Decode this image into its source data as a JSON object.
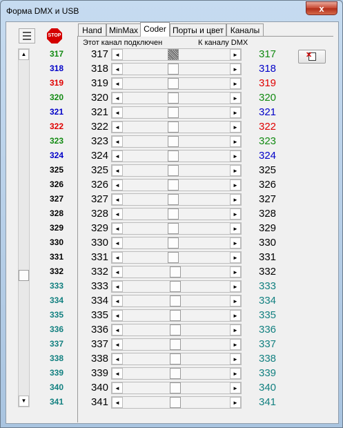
{
  "window": {
    "title": "Форма DMX и USB",
    "close_label": "x"
  },
  "toolbar": {
    "stop_label": "STOP"
  },
  "tabs": [
    {
      "label": "Hand",
      "active": false
    },
    {
      "label": "MinMax",
      "active": false
    },
    {
      "label": "Coder",
      "active": true
    },
    {
      "label": "Порты и цвет",
      "active": false
    },
    {
      "label": "Каналы",
      "active": false
    }
  ],
  "coder": {
    "header_left": "Этот канал подключен",
    "header_right": "К каналу DMX"
  },
  "channels": [
    {
      "channel": "317",
      "color": "#128a12",
      "slider_level": 0.47,
      "selected": true
    },
    {
      "channel": "318",
      "color": "#0000c8",
      "slider_level": 0.47
    },
    {
      "channel": "319",
      "color": "#e00000",
      "slider_level": 0.47
    },
    {
      "channel": "320",
      "color": "#128a12",
      "slider_level": 0.47
    },
    {
      "channel": "321",
      "color": "#0000c8",
      "slider_level": 0.47
    },
    {
      "channel": "322",
      "color": "#e00000",
      "slider_level": 0.47
    },
    {
      "channel": "323",
      "color": "#128a12",
      "slider_level": 0.47
    },
    {
      "channel": "324",
      "color": "#0000c8",
      "slider_level": 0.47
    },
    {
      "channel": "325",
      "color": "#000000",
      "slider_level": 0.47
    },
    {
      "channel": "326",
      "color": "#000000",
      "slider_level": 0.47
    },
    {
      "channel": "327",
      "color": "#000000",
      "slider_level": 0.47
    },
    {
      "channel": "328",
      "color": "#000000",
      "slider_level": 0.47
    },
    {
      "channel": "329",
      "color": "#000000",
      "slider_level": 0.47
    },
    {
      "channel": "330",
      "color": "#000000",
      "slider_level": 0.47
    },
    {
      "channel": "331",
      "color": "#000000",
      "slider_level": 0.47
    },
    {
      "channel": "332",
      "color": "#000000",
      "slider_level": 0.49
    },
    {
      "channel": "333",
      "color": "#128080",
      "slider_level": 0.49
    },
    {
      "channel": "334",
      "color": "#128080",
      "slider_level": 0.49
    },
    {
      "channel": "335",
      "color": "#128080",
      "slider_level": 0.49
    },
    {
      "channel": "336",
      "color": "#128080",
      "slider_level": 0.49
    },
    {
      "channel": "337",
      "color": "#128080",
      "slider_level": 0.49
    },
    {
      "channel": "338",
      "color": "#128080",
      "slider_level": 0.49
    },
    {
      "channel": "339",
      "color": "#128080",
      "slider_level": 0.49
    },
    {
      "channel": "340",
      "color": "#128080",
      "slider_level": 0.49
    },
    {
      "channel": "341",
      "color": "#128080",
      "slider_level": 0.49
    }
  ],
  "icons": {
    "list": "list-icon",
    "stop": "stop-icon",
    "scroll_up": "scroll-up-arrow-icon",
    "scroll_down": "scroll-down-arrow-icon",
    "arrow_left": "arrow-left-icon",
    "arrow_right": "arrow-right-icon",
    "document_delete": "document-delete-icon"
  }
}
